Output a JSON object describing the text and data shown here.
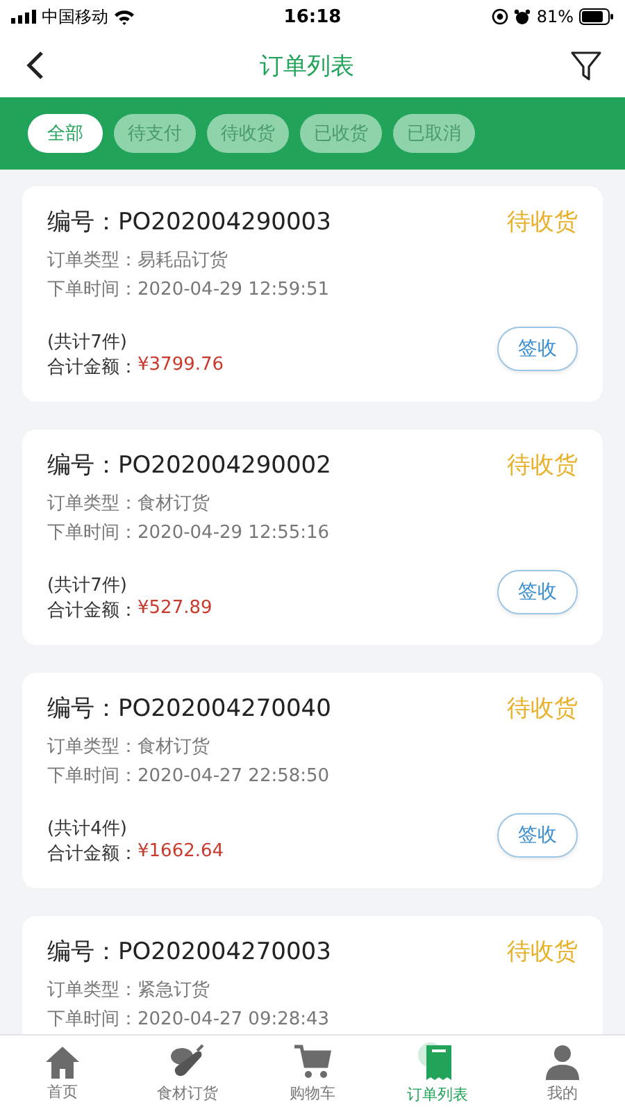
{
  "status_bar": {
    "carrier": "中国移动",
    "time": "16:18",
    "battery": "81%"
  },
  "nav": {
    "title": "订单列表"
  },
  "filters": [
    {
      "label": "全部",
      "selected": true
    },
    {
      "label": "待支付",
      "selected": false
    },
    {
      "label": "待收货",
      "selected": false
    },
    {
      "label": "已收货",
      "selected": false
    },
    {
      "label": "已取消",
      "selected": false
    }
  ],
  "orders": [
    {
      "number": "编号：PO202004290003",
      "status": "待收货",
      "type": "订单类型：易耗品订货",
      "time": "下单时间：2020-04-29 12:59:51",
      "count": "(共计7件)",
      "total_label": "合计金额：",
      "total": "¥3799.76",
      "action": "签收"
    },
    {
      "number": "编号：PO202004290002",
      "status": "待收货",
      "type": "订单类型：食材订货",
      "time": "下单时间：2020-04-29 12:55:16",
      "count": "(共计7件)",
      "total_label": "合计金额：",
      "total": "¥527.89",
      "action": "签收"
    },
    {
      "number": "编号：PO202004270040",
      "status": "待收货",
      "type": "订单类型：食材订货",
      "time": "下单时间：2020-04-27 22:58:50",
      "count": "(共计4件)",
      "total_label": "合计金额：",
      "total": "¥1662.64",
      "action": "签收"
    },
    {
      "number": "编号：PO202004270003",
      "status": "待收货",
      "type": "订单类型：紧急订货",
      "time": "下单时间：2020-04-27 09:28:43"
    }
  ],
  "tab_bar": [
    {
      "label": "首页",
      "kind": "home",
      "selected": false
    },
    {
      "label": "食材订货",
      "kind": "food",
      "selected": false
    },
    {
      "label": "购物车",
      "kind": "cart",
      "selected": false
    },
    {
      "label": "订单列表",
      "kind": "orders",
      "selected": true
    },
    {
      "label": "我的",
      "kind": "user",
      "selected": false
    }
  ]
}
